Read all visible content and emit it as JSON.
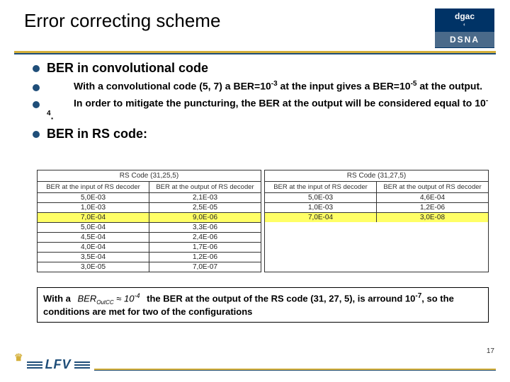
{
  "header": {
    "title": "Error correcting scheme",
    "logo_top": "dgac",
    "logo_bottom": "DSNA"
  },
  "bullets": {
    "b1": "BER in convolutional code",
    "b2_pre": "With a convolutional code (5, 7) a BER=10",
    "b2_exp1": "-3",
    "b2_mid": " at the input gives a BER=10",
    "b2_exp2": "-5",
    "b2_post": " at the output.",
    "b3_pre": "In order to mitigate the puncturing, the BER at the output will be considered equal to 10",
    "b3_exp": "-4",
    "b3_post": ".",
    "b4": "BER in RS code:"
  },
  "tableA": {
    "caption": "RS Code (31,25,5)",
    "col1": "BER at the input of RS decoder",
    "col2": "BER at the output of RS decoder",
    "rows": [
      {
        "in": "5,0E-03",
        "out": "2,1E-03",
        "hl": false
      },
      {
        "in": "1,0E-03",
        "out": "2,5E-05",
        "hl": false
      },
      {
        "in": "7,0E-04",
        "out": "9,0E-06",
        "hl": true
      },
      {
        "in": "5,0E-04",
        "out": "3,3E-06",
        "hl": false
      },
      {
        "in": "4,5E-04",
        "out": "2,4E-06",
        "hl": false
      },
      {
        "in": "4,0E-04",
        "out": "1,7E-06",
        "hl": false
      },
      {
        "in": "3,5E-04",
        "out": "1,2E-06",
        "hl": false
      },
      {
        "in": "3,0E-05",
        "out": "7,0E-07",
        "hl": false
      }
    ]
  },
  "tableB": {
    "caption": "RS Code (31,27,5)",
    "col1": "BER at the input of RS decoder",
    "col2": "BER at the output of RS decoder",
    "rows": [
      {
        "in": "5,0E-03",
        "out": "4,6E-04",
        "hl": false
      },
      {
        "in": "1,0E-03",
        "out": "1,2E-06",
        "hl": false
      },
      {
        "in": "7,0E-04",
        "out": "3,0E-08",
        "hl": true
      }
    ]
  },
  "note": {
    "pre": "With a ",
    "formula_sym": "BER",
    "formula_sub": "OutCC",
    "formula_approx": " ≈ 10",
    "formula_exp": "-4",
    "mid": " the BER at the output of the RS code (31, 27, 5), is arround 10",
    "mid_exp": "-7",
    "post": ", so the conditions are met for two of the  configurations"
  },
  "footer": {
    "page": "17",
    "brand": "LFV"
  }
}
